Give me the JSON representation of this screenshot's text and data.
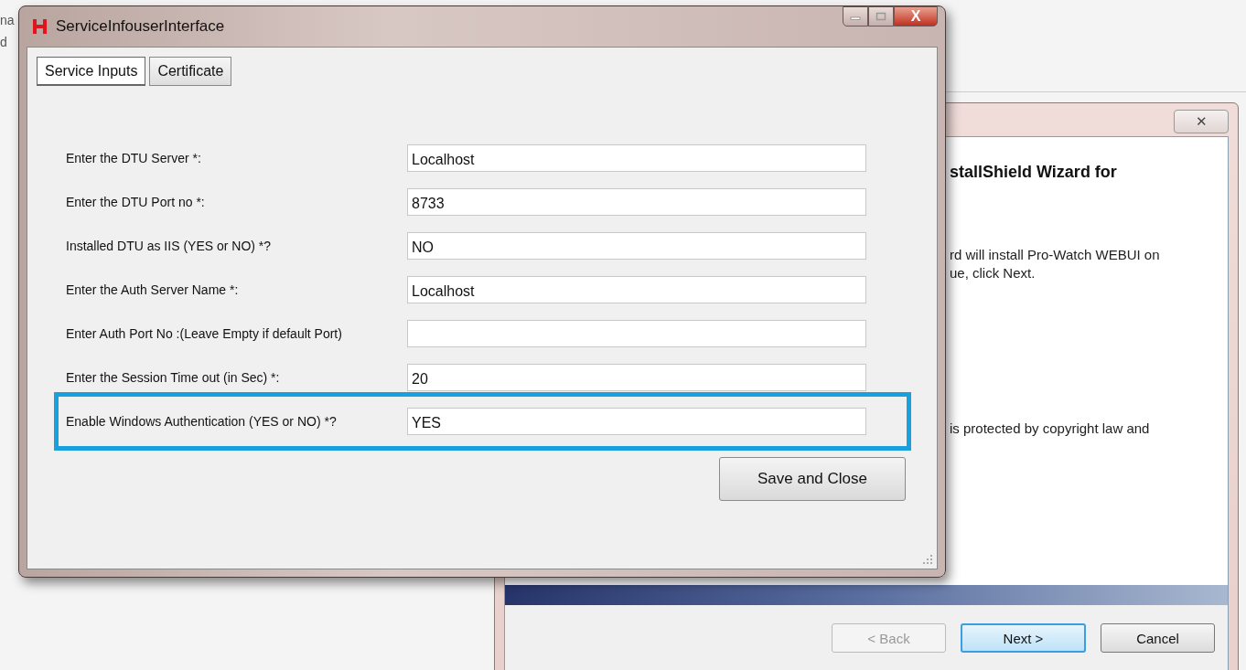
{
  "background": {
    "fragments": [
      "na",
      "d"
    ]
  },
  "installer": {
    "close": "✕",
    "blocks": [
      {
        "kind": "heading",
        "lines": [
          "stallShield Wizard for"
        ]
      },
      {
        "kind": "text",
        "lines": [
          "rd will install Pro-Watch WEBUI on",
          "ue, click Next."
        ]
      },
      {
        "kind": "text",
        "lines": [
          "is protected by copyright law and"
        ]
      }
    ],
    "buttons": [
      {
        "label": "< Back",
        "disabled": true,
        "default": false
      },
      {
        "label": "Next >",
        "disabled": false,
        "default": true
      },
      {
        "label": "Cancel",
        "disabled": false,
        "default": false
      }
    ]
  },
  "window": {
    "title": "ServiceInfouserInterface",
    "close": "X"
  },
  "tabs": [
    {
      "label": "Service Inputs",
      "selected": true
    },
    {
      "label": "Certificate",
      "selected": false
    }
  ],
  "fields": [
    {
      "label": "Enter the DTU Server *:",
      "value": "Localhost",
      "highlighted": false
    },
    {
      "label": "Enter the DTU Port no *:",
      "value": "8733",
      "highlighted": false
    },
    {
      "label": "Installed DTU as IIS (YES or NO) *?",
      "value": "NO",
      "highlighted": false
    },
    {
      "label": "Enter the Auth Server Name *:",
      "value": "Localhost",
      "highlighted": false
    },
    {
      "label": "Enter Auth Port No :(Leave Empty if default Port)",
      "highlighted": false
    },
    {
      "label": "Enter the Session Time out (in Sec) *:",
      "value": "20",
      "highlighted": false
    },
    {
      "label": "Enable Windows Authentication (YES or NO) *?",
      "value": "YES",
      "highlighted": true
    }
  ],
  "buttons": [
    "Save and Close"
  ]
}
